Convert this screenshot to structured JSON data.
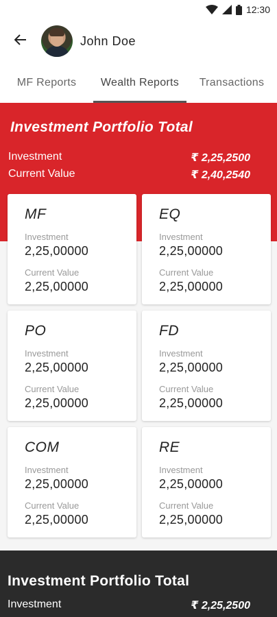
{
  "status_bar": {
    "time": "12:30"
  },
  "header": {
    "user_name": "John Doe"
  },
  "tabs": [
    {
      "label": "MF Reports"
    },
    {
      "label": "Wealth Reports",
      "active": true
    },
    {
      "label": "Transactions"
    }
  ],
  "portfolio_summary": {
    "title": "Investment Portfolio Total",
    "investment_label": "Investment",
    "investment_value": "₹ 2,25,2500",
    "current_value_label": "Current Value",
    "current_value": "₹ 2,40,2540"
  },
  "cards": [
    {
      "code": "MF",
      "investment_label": "Investment",
      "investment": "2,25,00000",
      "current_label": "Current Value",
      "current": "2,25,00000"
    },
    {
      "code": "EQ",
      "investment_label": "Investment",
      "investment": "2,25,00000",
      "current_label": "Current Value",
      "current": "2,25,00000"
    },
    {
      "code": "PO",
      "investment_label": "Investment",
      "investment": "2,25,00000",
      "current_label": "Current Value",
      "current": "2,25,00000"
    },
    {
      "code": "FD",
      "investment_label": "Investment",
      "investment": "2,25,00000",
      "current_label": "Current Value",
      "current": "2,25,00000"
    },
    {
      "code": "COM",
      "investment_label": "Investment",
      "investment": "2,25,00000",
      "current_label": "Current Value",
      "current": "2,25,00000"
    },
    {
      "code": "RE",
      "investment_label": "Investment",
      "investment": "2,25,00000",
      "current_label": "Current Value",
      "current": "2,25,00000"
    }
  ],
  "footer_summary": {
    "title": "Investment Portfolio Total",
    "investment_label": "Investment",
    "investment_value": "₹ 2,25,2500"
  },
  "colors": {
    "accent": "#d9252a",
    "footer_bg": "#2b2b2b"
  }
}
